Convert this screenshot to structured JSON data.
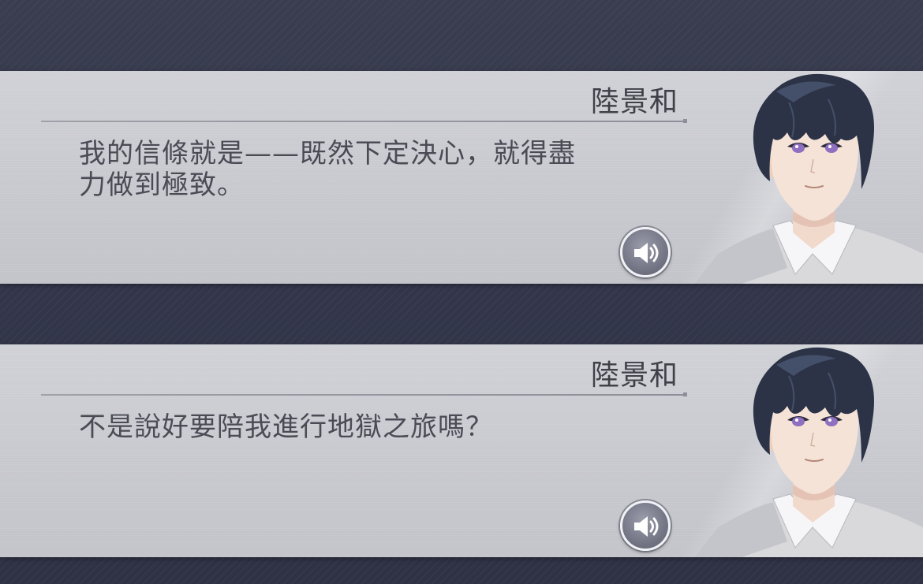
{
  "dialogue_log": {
    "entries": [
      {
        "speaker": "陸景和",
        "text_line1": "我的信條就是——既然下定決心，就得盡",
        "text_line2": "力做到極致。",
        "voice_icon": "speaker-volume-icon",
        "portrait": "character-portrait"
      },
      {
        "speaker": "陸景和",
        "text_line1": "不是說好要陪我進行地獄之旅嗎？",
        "text_line2": "",
        "voice_icon": "speaker-volume-icon",
        "portrait": "character-portrait"
      }
    ]
  },
  "colors": {
    "background": "#34374b",
    "panel": "#c9cad0",
    "text": "#4a4b54",
    "hair": "#2c3346",
    "eyes": "#8e6fc0"
  }
}
